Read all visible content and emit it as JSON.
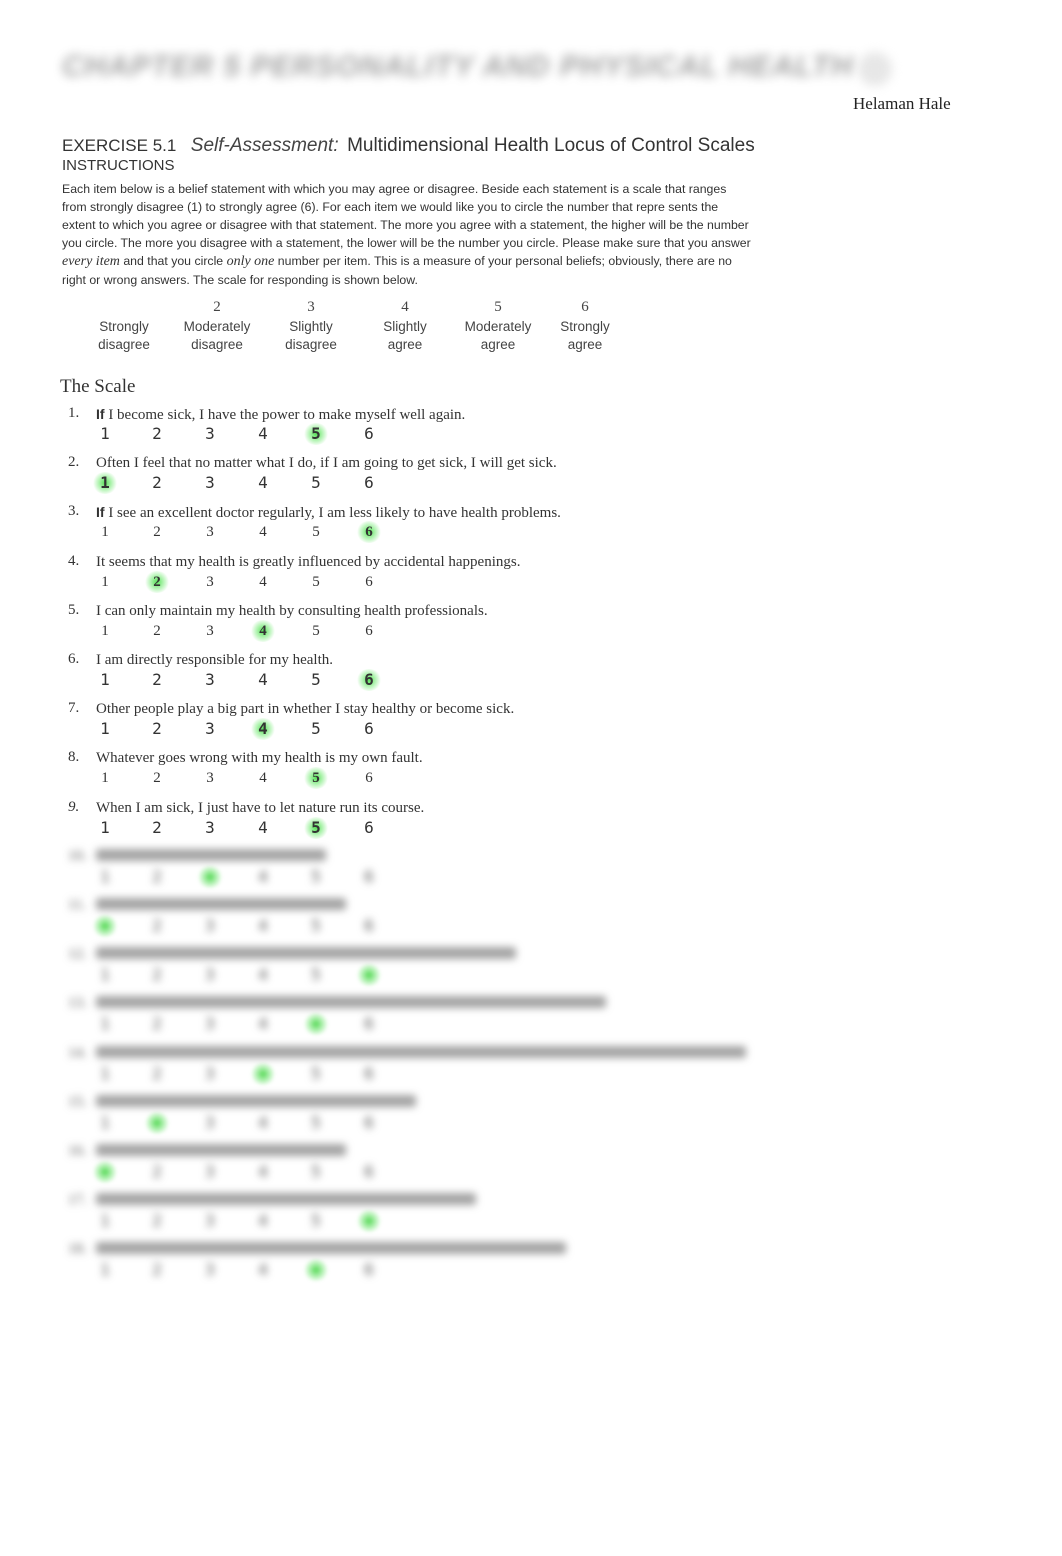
{
  "header": {
    "chapter_title": "CHAPTER 5 PERSONALITY AND PHYSICAL HEALTH",
    "page_mark": "",
    "author": "Helaman Hale"
  },
  "exercise": {
    "number": "EXERCISE  5.1",
    "self_assessment": "Self-Assessment:",
    "title": "Multidimensional Health Locus of Control Scales",
    "instructions_label": "INSTRUCTIONS",
    "instructions": {
      "part1": "Each item  below is a belief  statement with which you may agree or disagree. Beside each statement is a scale that ranges from  strongly disagree (1) to strongly agree (6). For each item we would like you to circle the   number that repre sents the extent to which you agree or disagree with that statement. The more you agree with a statement, the  higher will be the  number you circle. The more you disagree with  a statement, the lower will be the  number you circle. Please make sure that you answer ",
      "em1": "every item",
      "part2": " and that you circle ",
      "em2": "only one",
      "part3": " number per  item. This is a measure of your  personal beliefs; obviously, there are no right or wrong answers. The scale for  responding is shown  below."
    }
  },
  "response_scale": [
    {
      "number": "",
      "label_line1": "Strongly",
      "label_line2": "disagree"
    },
    {
      "number": "2",
      "label_line1": "Moderately",
      "label_line2": "disagree"
    },
    {
      "number": "3",
      "label_line1": "Slightly",
      "label_line2": "disagree"
    },
    {
      "number": "4",
      "label_line1": "Slightly",
      "label_line2": "agree"
    },
    {
      "number": "5",
      "label_line1": "Moderately",
      "label_line2": "agree"
    },
    {
      "number": "6",
      "label_line1": "Strongly",
      "label_line2": "agree"
    }
  ],
  "scale": {
    "title": "The Scale",
    "options": [
      "1",
      "2",
      "3",
      "4",
      "5",
      "6"
    ],
    "items": [
      {
        "number": "1.",
        "lead": "If",
        "text": " I become sick, I have the power to make myself well  again.",
        "selected": 5,
        "blurred": false
      },
      {
        "number": "2.",
        "lead": "",
        "text": "Often I feel that no matter what I do, if I am going to get sick, I will get  sick.",
        "selected": 1,
        "blurred": false
      },
      {
        "number": "3.",
        "lead": "If",
        "text": " I see an excellent doctor regularly,  I am less likely to have health problems.",
        "selected": 6,
        "blurred": false
      },
      {
        "number": "4.",
        "lead": "",
        "text": "It seems that my health is greatly influenced by accidental happenings.",
        "selected": 2,
        "blurred": false
      },
      {
        "number": "5.",
        "lead": "",
        "text": "I can only maintain my health by consulting health  professionals.",
        "selected": 4,
        "blurred": false
      },
      {
        "number": "6.",
        "lead": "",
        "text": "I am directly responsible for my health.",
        "selected": 6,
        "blurred": false
      },
      {
        "number": "7.",
        "lead": "",
        "text": "Other people play a big part in whether I stay healthy or become sick.",
        "selected": 4,
        "blurred": false
      },
      {
        "number": "8.",
        "lead": "",
        "text": "Whatever goes wrong with my health is my own fault.",
        "selected": 5,
        "blurred": false
      },
      {
        "number": "9.",
        "lead": "",
        "text": "When I am sick, I just have to let nature run its course.",
        "selected": 5,
        "blurred": false
      },
      {
        "number": "10.",
        "lead": "",
        "text": "",
        "selected": 3,
        "blurred": true
      },
      {
        "number": "11.",
        "lead": "",
        "text": "",
        "selected": 1,
        "blurred": true
      },
      {
        "number": "12.",
        "lead": "",
        "text": "",
        "selected": 6,
        "blurred": true
      },
      {
        "number": "13.",
        "lead": "",
        "text": "",
        "selected": 5,
        "blurred": true
      },
      {
        "number": "14.",
        "lead": "",
        "text": "",
        "selected": 4,
        "blurred": true
      },
      {
        "number": "15.",
        "lead": "",
        "text": "",
        "selected": 2,
        "blurred": true
      },
      {
        "number": "16.",
        "lead": "",
        "text": "",
        "selected": 1,
        "blurred": true
      },
      {
        "number": "17.",
        "lead": "",
        "text": "",
        "selected": 6,
        "blurred": true
      },
      {
        "number": "18.",
        "lead": "",
        "text": "",
        "selected": 5,
        "blurred": true
      }
    ]
  },
  "colors": {
    "highlight": "#3cdc3c",
    "text": "#333333"
  }
}
